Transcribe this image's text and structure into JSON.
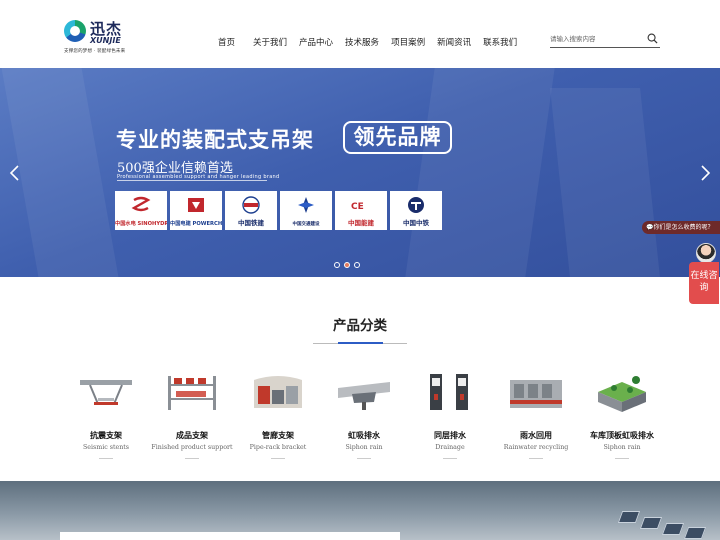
{
  "header": {
    "logo_cn": "迅杰",
    "logo_en": "XUNJIE",
    "logo_slogan": "支撑您的梦想 · 装配绿色未来",
    "search_placeholder": "请输入搜索内容"
  },
  "nav": {
    "items": [
      {
        "label": "首页"
      },
      {
        "label": "关于我们"
      },
      {
        "label": "产品中心"
      },
      {
        "label": "技术服务"
      },
      {
        "label": "项目案例"
      },
      {
        "label": "新闻资讯"
      },
      {
        "label": "联系我们"
      }
    ]
  },
  "banner": {
    "headline": "专业的装配式支吊架",
    "headline_boxed": "领先品牌",
    "subhead": "500强企业信赖首选",
    "subhead_en": "Professional assembled support and hanger leading brand",
    "partners": [
      {
        "label": "中国水电 SINOHYDRO",
        "icon": "sinohydro-logo"
      },
      {
        "label": "中国电建 POWERCHINA",
        "icon": "powerchina-logo"
      },
      {
        "label": "中国铁建",
        "icon": "crcc-logo"
      },
      {
        "label": "中国交通建设",
        "icon": "cccc-logo"
      },
      {
        "label": "中国能建",
        "icon": "ceec-logo"
      },
      {
        "label": "中国中铁",
        "icon": "crec-logo"
      }
    ],
    "slides_total": 3,
    "active_slide": 2
  },
  "consult": {
    "bubble": "你们是怎么收费的呢？",
    "box_label": "在线咨询"
  },
  "products": {
    "title": "产品分类",
    "items": [
      {
        "name": "抗震支架",
        "en": "Seismic stents"
      },
      {
        "name": "成品支架",
        "en": "Finished product support"
      },
      {
        "name": "管廊支架",
        "en": "Pipe-rack bracket"
      },
      {
        "name": "虹吸排水",
        "en": "Siphon rain"
      },
      {
        "name": "同层排水",
        "en": "Drainage"
      },
      {
        "name": "雨水回用",
        "en": "Rainwater recycling"
      },
      {
        "name": "车库顶板虹吸排水",
        "en": "Siphon rain"
      }
    ]
  },
  "colors": {
    "banner": "#3f5fae",
    "accent": "#2c5cc5",
    "consult": "#e24d4d"
  }
}
